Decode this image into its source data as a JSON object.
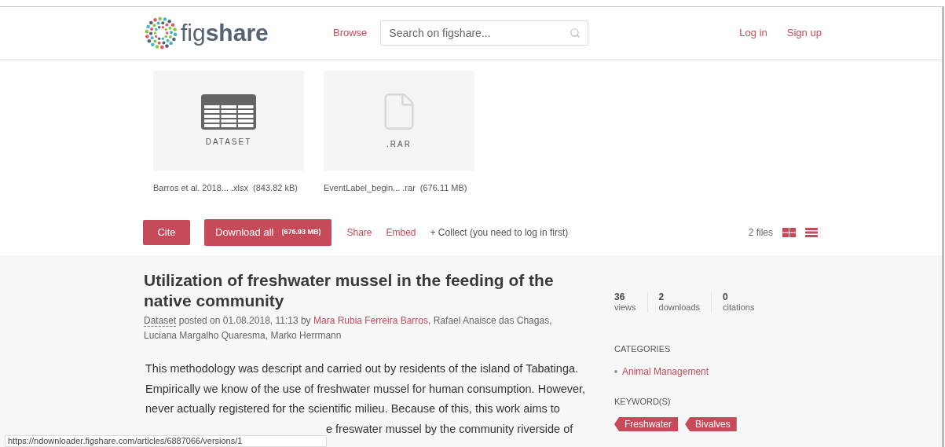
{
  "header": {
    "logo": "fig**share**",
    "nav": [
      {
        "label": "Browse"
      }
    ],
    "search": {
      "placeholder": "Search on figshare..."
    },
    "account": [
      {
        "label": "Log in"
      },
      {
        "label": "Sign up"
      }
    ]
  },
  "files": [
    {
      "kind": "dataset",
      "thumb_label": "DATASET",
      "name": "Barros et al. 2018... .xlsx",
      "size": "(843.82 kB)"
    },
    {
      "kind": "file",
      "thumb_label": ".RAR",
      "name": "EventLabel_begin... .rar",
      "size": "(676.11 MB)"
    }
  ],
  "actions": {
    "cite": "Cite",
    "download": "Download all",
    "download_size": "(676.93 MB)",
    "links": [
      "Share",
      "Embed"
    ],
    "collect": "+ Collect (you need to log in first)",
    "file_count": "2 files"
  },
  "article": {
    "title": "Utilization of freshwater mussel in the feeding of the native community",
    "type": "Dataset",
    "posted": "posted on 01.08.2018, 11:13 by",
    "authors": [
      {
        "name": "Mara Rubia Ferreira Barros,",
        "linked": true
      },
      {
        "name": "Rafael Anaisce das Chagas,",
        "linked": false
      },
      {
        "name": "Luciana Margalho Quaresma,",
        "linked": false
      },
      {
        "name": "Marko Herrmann",
        "linked": false
      }
    ],
    "description": "This methodology was descript and carried out by residents of the island of Tabatinga. Empirically we know of the use of freshwater mussel for human consumption. However, never actually registered for the scientific milieu. Because of this, this work aims to",
    "description_tail": "e freswater mussel by the community riverside of"
  },
  "stats": [
    {
      "value": "36",
      "label": "views"
    },
    {
      "value": "2",
      "label": "downloads"
    },
    {
      "value": "0",
      "label": "citations"
    }
  ],
  "categories": {
    "heading": "CATEGORIES",
    "items": [
      "Animal Management"
    ]
  },
  "keywords": {
    "heading": "KEYWORD(S)",
    "items": [
      "Freshwater",
      "Bivalves"
    ]
  },
  "status_bar": "https://ndownloader.figshare.com/articles/6887066/versions/1"
}
